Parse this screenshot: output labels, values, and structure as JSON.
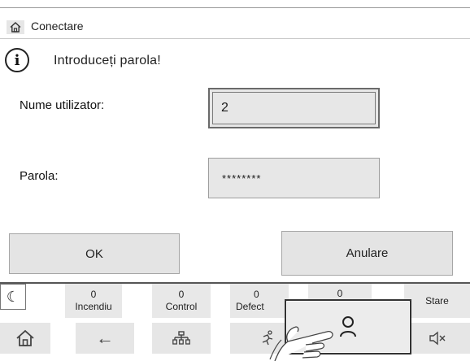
{
  "breadcrumb": {
    "home_icon": "home-icon",
    "label": "Conectare"
  },
  "info": {
    "icon": "info-icon",
    "glyph": "i",
    "message": "Introduceți parola!"
  },
  "form": {
    "username_label": "Nume utilizator:",
    "username_value": "2",
    "password_label": "Parola:",
    "password_value": "********"
  },
  "buttons": {
    "ok": "OK",
    "cancel": "Anulare"
  },
  "status": {
    "moon_glyph": "☾",
    "incendiu": {
      "count": "0",
      "label": "Incendiu"
    },
    "control": {
      "count": "0",
      "label": "Control"
    },
    "defect": {
      "count": "0",
      "label": "Defect"
    },
    "other": {
      "count": "0"
    },
    "stare": "Stare"
  },
  "nav": {
    "home": "home-icon",
    "back": "←",
    "network": "network-icon",
    "evacuation": "running-person-icon",
    "mute": "speaker-mute-icon"
  },
  "login_popup": {
    "icon": "user-icon"
  }
}
